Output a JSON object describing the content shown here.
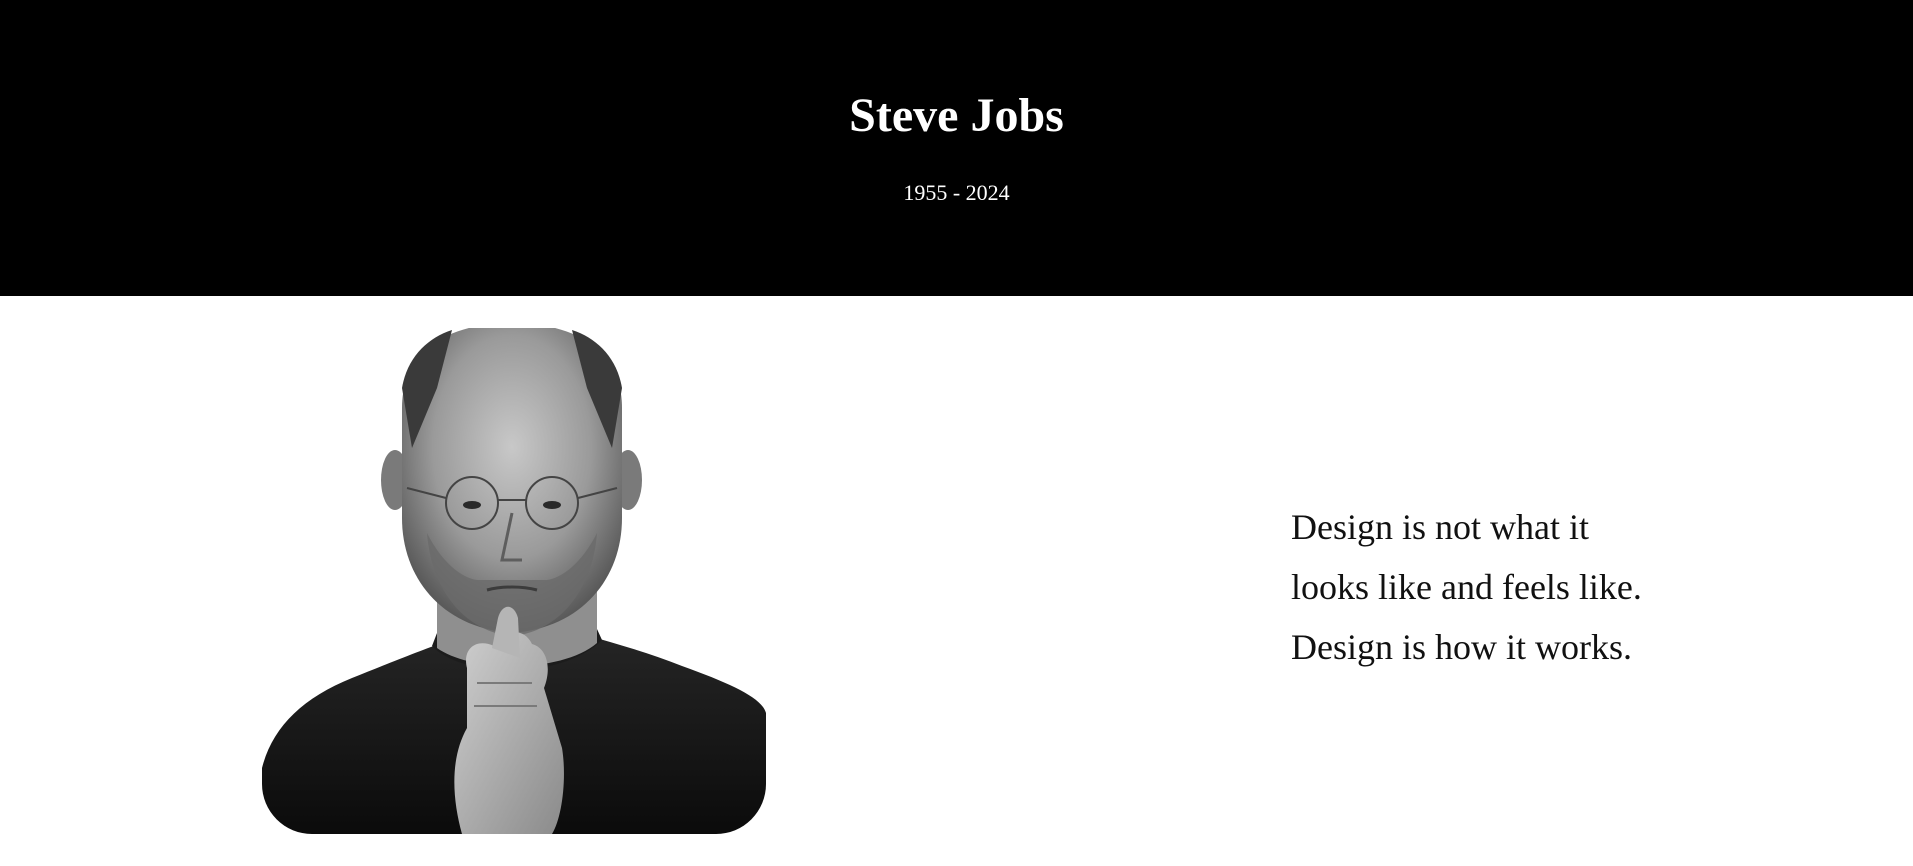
{
  "header": {
    "name": "Steve Jobs",
    "years": "1955 - 2024"
  },
  "portrait": {
    "alt": "Steve Jobs portrait"
  },
  "quote": {
    "lines": [
      "Design is not what it",
      "looks like and feels like.",
      "Design is how it works."
    ]
  },
  "colors": {
    "header_background": "#000000",
    "header_text": "#ffffff",
    "page_background": "#ffffff",
    "body_text": "#111111"
  }
}
